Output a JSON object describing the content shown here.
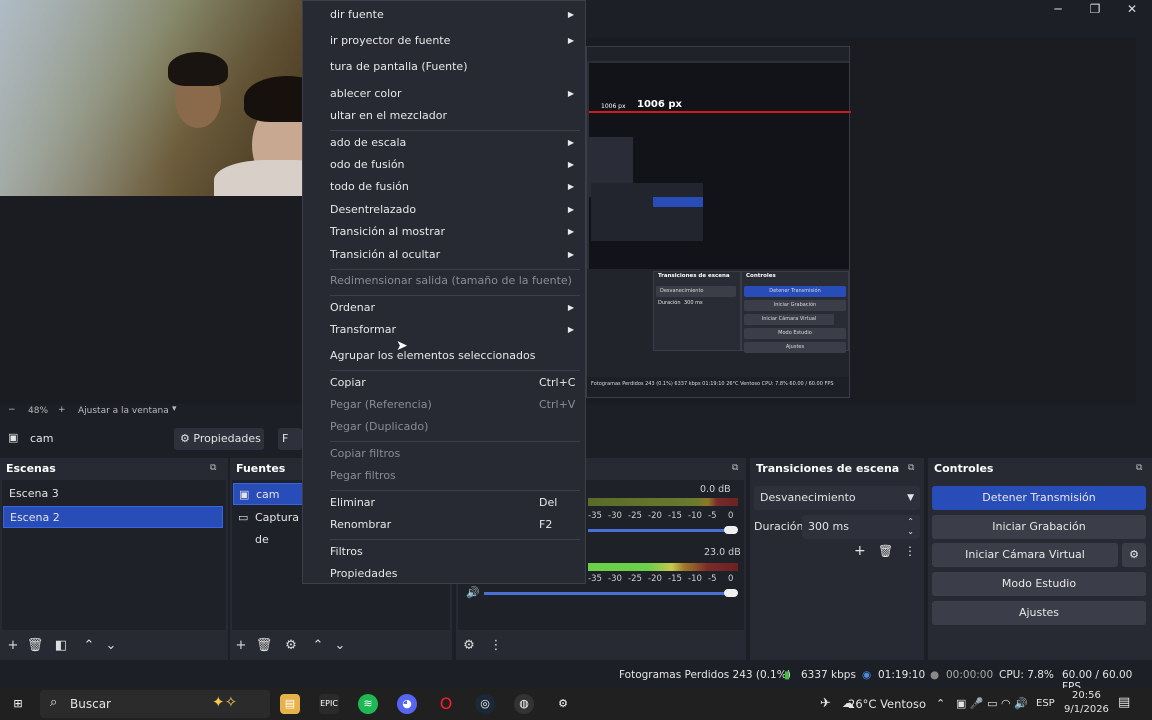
{
  "window": {
    "minimize": "─",
    "maximize": "❐",
    "close": "✕"
  },
  "nested_preview": {
    "px_label": "1006 px",
    "px_small": "1006 px",
    "transiciones_title": "Transiciones de escena",
    "controles_title": "Controles",
    "transition_value": "Desvanecimiento",
    "duracion_label": "Duración",
    "duracion_value": "300 ms",
    "btn_stop": "Detener Transmisión",
    "btn_record": "Iniciar Grabación",
    "btn_vcam": "Iniciar Cámara Virtual",
    "btn_studio": "Modo Estudio",
    "btn_settings": "Ajustes",
    "status": "Fotogramas Perdidos 243 (0.1%)   6337 kbps   01:19:10   26°C Ventoso   CPU: 7.8%  60.00 / 60.00 FPS",
    "clock_time": "20:56",
    "clock_date": "9/1/2026"
  },
  "preview_toolbar": {
    "minus": "−",
    "zoom": "48%",
    "plus": "+",
    "fit": "Ajustar a la ventana",
    "dropdown": "▾"
  },
  "source_bar": {
    "source_name": "cam",
    "properties": "Propiedades",
    "filters_partial": "F"
  },
  "scenes": {
    "title": "Escenas",
    "items": [
      "Escena 3",
      "Escena 2"
    ],
    "selected_index": 1
  },
  "sources": {
    "title": "Fuentes",
    "items": [
      "cam",
      "Captura de"
    ]
  },
  "mixer": {
    "ch1_db": "0.0 dB",
    "ch2_db": "23.0 dB",
    "ticks": [
      "-35",
      "-30",
      "-25",
      "-20",
      "-15",
      "-10",
      "-5",
      "0"
    ]
  },
  "transitions": {
    "title": "Transiciones de escena",
    "selected": "Desvanecimiento",
    "duration_label": "Duración",
    "duration_value": "300 ms"
  },
  "controls": {
    "title": "Controles",
    "stop_stream": "Detener Transmisión",
    "start_record": "Iniciar Grabación",
    "start_vcam": "Iniciar Cámara Virtual",
    "studio_mode": "Modo Estudio",
    "settings": "Ajustes"
  },
  "status": {
    "dropped": "Fotogramas Perdidos 243 (0.1%)",
    "bitrate": "6337 kbps",
    "stream_time": "01:19:10",
    "record_time": "00:00:00",
    "cpu": "CPU: 7.8%",
    "fps": "60.00 / 60.00 FPS"
  },
  "taskbar": {
    "search": "Buscar",
    "weather": "26°C  Ventoso",
    "lang": "ESP",
    "time": "20:56",
    "date": "9/1/2026"
  },
  "context_menu": {
    "items": [
      {
        "label": "dir fuente",
        "arrow": true,
        "disabled": false
      },
      {
        "label": "ir proyector de fuente",
        "arrow": true,
        "disabled": false
      },
      {
        "label": "tura de pantalla (Fuente)",
        "arrow": false,
        "disabled": false
      },
      {
        "label": "ablecer color",
        "arrow": true,
        "disabled": false
      },
      {
        "label": "ultar en el mezclador",
        "arrow": false,
        "disabled": false
      },
      {
        "label": "ado de escala",
        "arrow": true,
        "disabled": false
      },
      {
        "label": "odo de fusión",
        "arrow": true,
        "disabled": false
      },
      {
        "label": "todo de fusión",
        "arrow": true,
        "disabled": false
      },
      {
        "label": "Desentrelazado",
        "arrow": true,
        "disabled": false
      },
      {
        "label": "Transición al mostrar",
        "arrow": true,
        "disabled": false
      },
      {
        "label": "Transición al ocultar",
        "arrow": true,
        "disabled": false
      },
      {
        "label": "Redimensionar salida (tamaño de la fuente)",
        "arrow": false,
        "disabled": true
      },
      {
        "label": "Ordenar",
        "arrow": true,
        "disabled": false
      },
      {
        "label": "Transformar",
        "arrow": true,
        "disabled": false
      },
      {
        "label": "Agrupar los elementos seleccionados",
        "arrow": false,
        "disabled": false
      },
      {
        "label": "Copiar",
        "shortcut": "Ctrl+C",
        "disabled": false
      },
      {
        "label": "Pegar (Referencia)",
        "shortcut": "Ctrl+V",
        "disabled": true
      },
      {
        "label": "Pegar (Duplicado)",
        "disabled": true
      },
      {
        "label": "Copiar filtros",
        "disabled": true
      },
      {
        "label": "Pegar filtros",
        "disabled": true
      },
      {
        "label": "Eliminar",
        "shortcut": "Del",
        "disabled": false
      },
      {
        "label": "Renombrar",
        "shortcut": "F2",
        "disabled": false
      },
      {
        "label": "Filtros",
        "disabled": false
      },
      {
        "label": "Propiedades",
        "disabled": false
      }
    ]
  },
  "colors": {
    "accent": "#284cb8",
    "bg": "#1d1f26",
    "dock": "#272a33",
    "red": "#d21a1a"
  }
}
